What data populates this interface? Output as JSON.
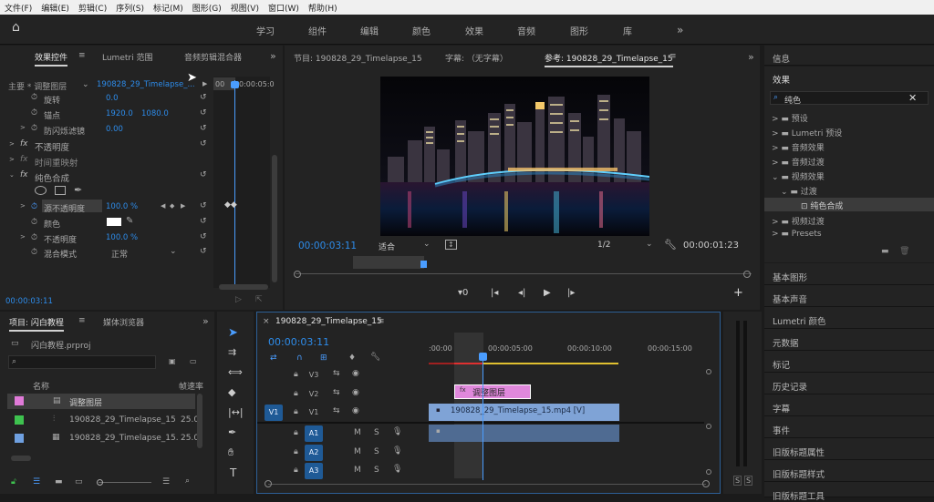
{
  "menubar": [
    "文件(F)",
    "编辑(E)",
    "剪辑(C)",
    "序列(S)",
    "标记(M)",
    "图形(G)",
    "视图(V)",
    "窗口(W)",
    "帮助(H)"
  ],
  "workspaces": [
    "学习",
    "组件",
    "编辑",
    "颜色",
    "效果",
    "音频",
    "图形",
    "库"
  ],
  "effect_controls": {
    "tabs": [
      "效果控件",
      "Lumetri 范围",
      "音频剪辑混合器"
    ],
    "master": "主要 * 调整图层",
    "clip": "190828_29_Timelapse_...",
    "ruler_start": "00",
    "ruler_time": "0:00:05:0",
    "rows": [
      {
        "label": "旋转",
        "v1": "0.0",
        "v2": ""
      },
      {
        "label": "锚点",
        "v1": "1920.0",
        "v2": "1080.0"
      },
      {
        "label": "防闪烁滤镜",
        "v1": "0.00",
        "v2": ""
      }
    ],
    "fx": [
      "不透明度",
      "时间重映射",
      "纯色合成"
    ],
    "sub": [
      {
        "label": "源不透明度",
        "value": "100.0 %"
      },
      {
        "label": "颜色",
        "value": ""
      },
      {
        "label": "不透明度",
        "value": "100.0 %"
      },
      {
        "label": "混合模式",
        "value": "正常"
      }
    ],
    "timecode": "00:00:03:11"
  },
  "monitor": {
    "tabs": [
      "节目: 190828_29_Timelapse_15",
      "字幕: （无字幕）",
      "参考: 190828_29_Timelapse_15"
    ],
    "timecode": "00:00:03:11",
    "fit": "适合",
    "quality": "1/2",
    "duration": "00:00:01:23"
  },
  "right": {
    "info": "信息",
    "effects": "效果",
    "search": "纯色",
    "tree": [
      "预设",
      "Lumetri 预设",
      "音频效果",
      "音频过渡",
      "视频效果",
      "过渡",
      "纯色合成",
      "视频过渡",
      "Presets"
    ],
    "panels": [
      "基本图形",
      "基本声音",
      "Lumetri 颜色",
      "元数据",
      "标记",
      "历史记录",
      "字幕",
      "事件",
      "旧版标题属性",
      "旧版标题样式",
      "旧版标题工具"
    ]
  },
  "project": {
    "tabs": [
      "项目: 闪白教程",
      "媒体浏览器"
    ],
    "file": "闪白教程.prproj",
    "col_name": "名称",
    "col_rate": "帧速率",
    "items": [
      {
        "name": "调整图层",
        "rate": "",
        "color": "#e07ad8"
      },
      {
        "name": "190828_29_Timelapse_15",
        "rate": "25.0",
        "color": "#3ec24f"
      },
      {
        "name": "190828_29_Timelapse_15.",
        "rate": "25.0",
        "color": "#6fa0e0"
      }
    ]
  },
  "timeline": {
    "tab": "190828_29_Timelapse_15",
    "timecode": "00:00:03:11",
    "ruler": [
      ":00:00",
      "00:00:05:00",
      "00:00:10:00",
      "00:00:15:00"
    ],
    "tracks_v": [
      "V3",
      "V2",
      "V1"
    ],
    "tracks_a": [
      "A1",
      "A2",
      "A3"
    ],
    "src_v": "V1",
    "adj_clip": "调整图层",
    "video_clip": "190828_29_Timelapse_15.mp4 [V]"
  },
  "colors": {
    "accent": "#2d8ceb",
    "playhead": "#4a9dff"
  }
}
